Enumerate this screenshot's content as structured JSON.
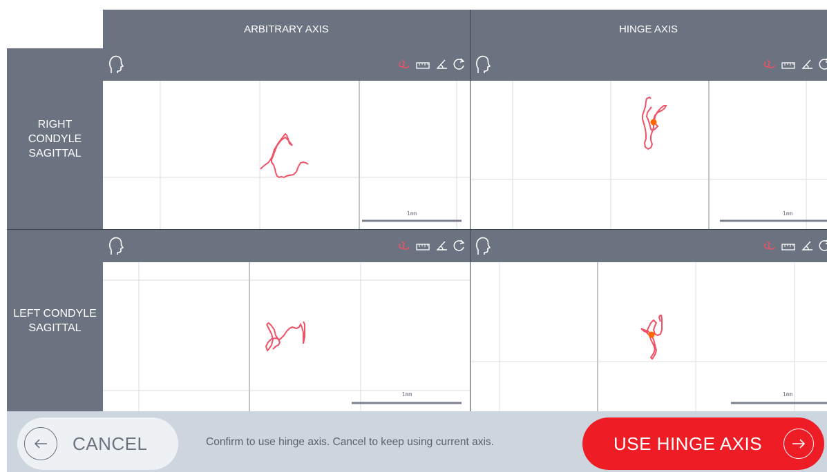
{
  "columns": {
    "arbitrary": "ARBITRARY AXIS",
    "hinge": "HINGE AXIS"
  },
  "rows": {
    "right": "RIGHT\nCONDYLE\nSAGITTAL",
    "left": "LEFT CONDYLE\nSAGITTAL"
  },
  "scale_label": "1mm",
  "icons": [
    "head-profile-icon",
    "trace-pen-icon",
    "ruler-icon",
    "angle-icon",
    "reset-icon"
  ],
  "colors": {
    "trace": "#ee5266",
    "hinge_point": "#ff6600",
    "header": "#6b7280",
    "accent": "#ee1c25"
  },
  "footer": {
    "cancel_label": "CANCEL",
    "message": "Confirm to use hinge axis. Cancel to keep using current axis.",
    "confirm_label": "USE HINGE AXIS"
  }
}
